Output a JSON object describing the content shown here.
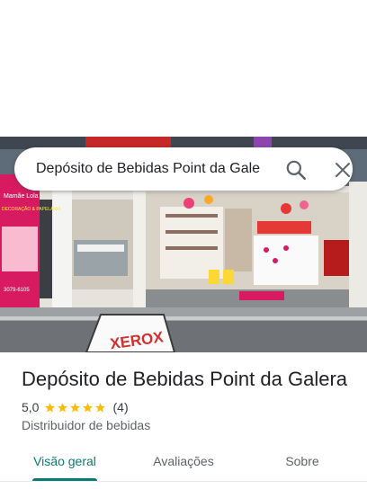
{
  "search": {
    "value": "Depósito de Bebidas Point da Galera",
    "search_icon": "search-icon",
    "close_icon": "close-icon"
  },
  "photo": {
    "banner_text": "Mamãe Lola",
    "banner_subtitle": "DECORAÇÃO & PAPELARIA",
    "banner_phone": "3079-6105",
    "sign_text": "XEROX"
  },
  "place": {
    "title": "Depósito de Bebidas Point da Galera",
    "rating": "5,0",
    "rating_stars": 5,
    "review_count": "4",
    "category": "Distribuidor de bebidas"
  },
  "tabs": [
    {
      "label": "Visão geral",
      "selected": true
    },
    {
      "label": "Avaliações",
      "selected": false
    },
    {
      "label": "Sobre",
      "selected": false
    }
  ],
  "colors": {
    "accent": "#0b7a75",
    "star": "#fbbc04"
  }
}
